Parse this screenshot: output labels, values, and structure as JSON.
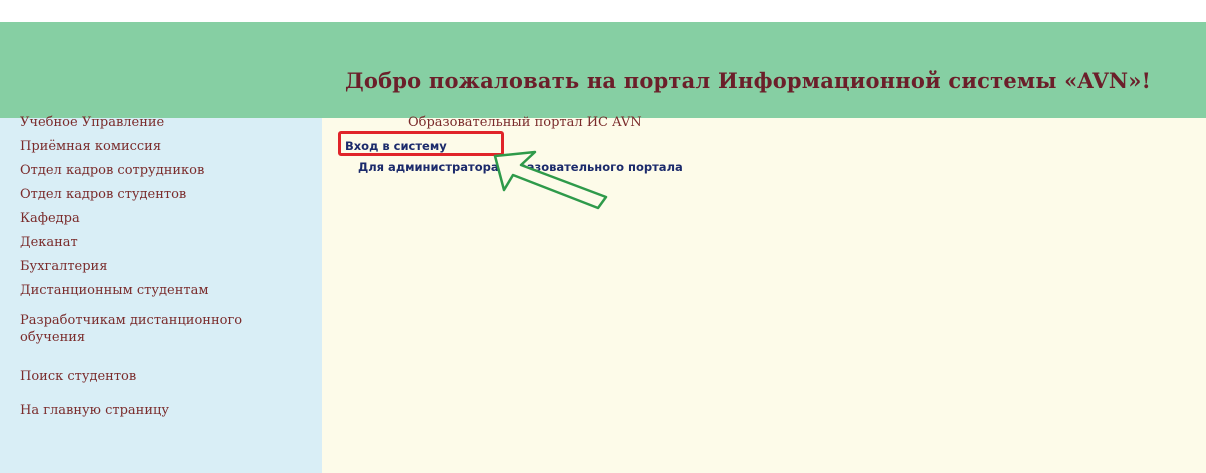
{
  "header": {
    "title": "Добро пожаловать на портал Информационной системы «AVN»!"
  },
  "sidebar": {
    "items": [
      {
        "label": "Учебное Управление"
      },
      {
        "label": "Приёмная комиссия"
      },
      {
        "label": "Отдел кадров сотрудников"
      },
      {
        "label": "Отдел кадров студентов"
      },
      {
        "label": "Кафедра"
      },
      {
        "label": "Деканат"
      },
      {
        "label": "Бухгалтерия"
      },
      {
        "label": "Дистанционным студентам"
      },
      {
        "label": "Разработчикам дистанционного обучения"
      },
      {
        "label": "Поиск студентов"
      },
      {
        "label": "На главную страницу"
      }
    ]
  },
  "main": {
    "portal_title": "Образовательный портал ИС AVN",
    "login_link": "Вход в систему",
    "admin_link": "Для администратора образовательного портала"
  },
  "colors": {
    "header_bg": "#86cfa3",
    "sidebar_bg": "#d9eef6",
    "main_bg": "#fdfbe9",
    "title_color": "#6b1f2a",
    "link_color": "#1b2a6b",
    "highlight_color": "#e0242a",
    "arrow_color": "#2e9a4a"
  },
  "annotations": {
    "highlight_box": "red-rectangle",
    "pointer": "green-arrow-icon"
  }
}
